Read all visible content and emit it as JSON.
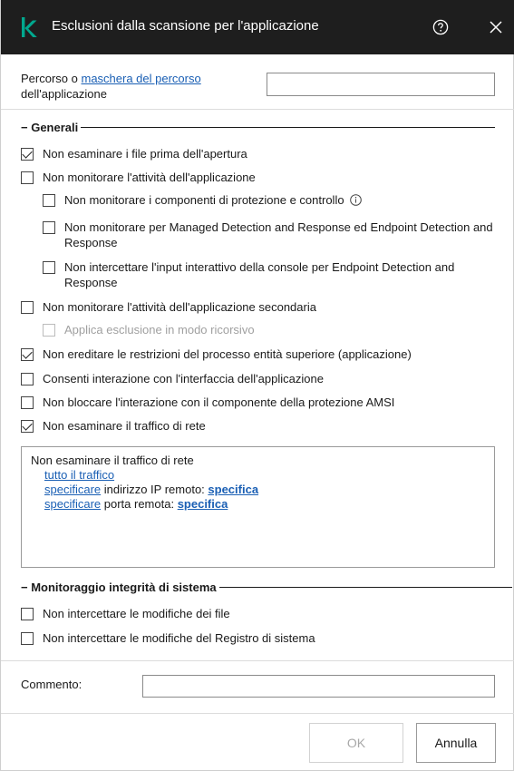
{
  "window": {
    "title": "Esclusioni dalla scansione per l'applicazione",
    "help_icon": "help-circle-icon",
    "close_icon": "close-icon"
  },
  "path": {
    "label_prefix": "Percorso o ",
    "label_link": "maschera del percorso",
    "label_suffix": "dell'applicazione",
    "value": ""
  },
  "general": {
    "title": "Generali",
    "collapse_glyph": "−",
    "items": [
      {
        "label": "Non esaminare i file prima dell'apertura",
        "checked": true
      },
      {
        "label": "Non monitorare l'attività dell'applicazione",
        "checked": false
      },
      {
        "label": "Non monitorare i componenti di protezione e controllo",
        "checked": false,
        "info_icon": "info-icon"
      },
      {
        "label": "Non monitorare per Managed Detection and Response ed Endpoint Detection and Response",
        "checked": false
      },
      {
        "label": "Non intercettare l'input interattivo della console per Endpoint Detection and Response",
        "checked": false
      },
      {
        "label": "Non monitorare l'attività dell'applicazione secondaria",
        "checked": false
      },
      {
        "label": "Applica esclusione in modo ricorsivo",
        "checked": false,
        "disabled": true
      },
      {
        "label": "Non ereditare le restrizioni del processo entità superiore (applicazione)",
        "checked": true
      },
      {
        "label": "Consenti interazione con l'interfaccia dell'applicazione",
        "checked": false
      },
      {
        "label": "Non bloccare l'interazione con il componente della protezione AMSI",
        "checked": false
      },
      {
        "label": "Non esaminare il traffico di rete",
        "checked": true
      }
    ]
  },
  "network_box": {
    "heading": "Non esaminare il traffico di rete",
    "all_traffic_link": "tutto il traffico",
    "ip_link": "specificare",
    "ip_text": " indirizzo IP remoto: ",
    "ip_value_link": "specifica",
    "port_link": "specificare",
    "port_text": " porta remota: ",
    "port_value_link": "specifica"
  },
  "integrity": {
    "title": "Monitoraggio integrità di sistema",
    "collapse_glyph": "−",
    "items": [
      {
        "label": "Non intercettare le modifiche dei file",
        "checked": false
      },
      {
        "label": "Non intercettare le modifiche del Registro di sistema",
        "checked": false
      }
    ]
  },
  "comment": {
    "label": "Commento:",
    "value": ""
  },
  "buttons": {
    "ok": "OK",
    "ok_disabled": true,
    "cancel": "Annulla"
  },
  "colors": {
    "titlebar": "#1e1e1e",
    "brand": "#00a88e",
    "link": "#1a5fb4"
  }
}
